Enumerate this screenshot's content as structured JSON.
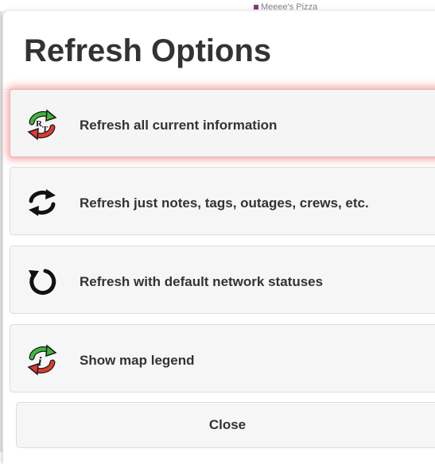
{
  "background": {
    "stub_text": "Meeee's Pizza"
  },
  "dialog": {
    "title": "Refresh Options",
    "options": [
      {
        "label": "Refresh all current information",
        "icon": "refresh-rt-icon",
        "active": true
      },
      {
        "label": "Refresh just notes, tags, outages, crews, etc.",
        "icon": "refresh-arrows-icon",
        "active": false
      },
      {
        "label": "Refresh with default network statuses",
        "icon": "reload-icon",
        "active": false
      },
      {
        "label": "Show map legend",
        "icon": "info-refresh-icon",
        "active": false
      }
    ],
    "close_label": "Close"
  },
  "colors": {
    "arrow_green": "#3cb83c",
    "arrow_red": "#e03a2e",
    "glow_red": "#eb3c3c",
    "text": "#333333",
    "button_bg": "#f6f6f6"
  }
}
